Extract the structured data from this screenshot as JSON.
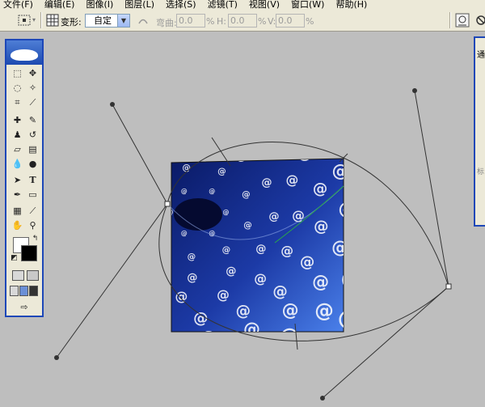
{
  "menu": [
    "文件(F)",
    "编辑(E)",
    "图像(I)",
    "图层(L)",
    "选择(S)",
    "滤镜(T)",
    "视图(V)",
    "窗口(W)",
    "帮助(H)"
  ],
  "options": {
    "warp_label": "变形:",
    "warp_value": "自定",
    "bend_label": "弯曲:",
    "bend_value": "0.0",
    "bend_unit": "%",
    "h_label": "H:",
    "h_value": "0.0",
    "h_unit": "%",
    "v_label": "V:",
    "v_value": "0.0",
    "v_unit": "%"
  },
  "toolbox": {
    "tools": [
      "rect-marquee",
      "move",
      "lasso",
      "magic-wand",
      "crop",
      "slice",
      "healing-brush",
      "brush",
      "clone-stamp",
      "history-brush",
      "eraser",
      "gradient",
      "blur",
      "dodge",
      "path-select",
      "type",
      "pen",
      "rectangle-shape",
      "notes",
      "eyedropper",
      "hand",
      "zoom"
    ],
    "type_glyph": "T"
  },
  "right_panel": {
    "tab_text": "通",
    "bottom_text": "标"
  },
  "image": {
    "glyph": "@",
    "bg_dark": "#0a1a66",
    "bg_light": "#3a6ee0",
    "text_color": "#ffffff"
  },
  "colors": {
    "accent": "#1d47b8",
    "canvas_bg": "#bebebe",
    "chrome": "#ece9d8"
  }
}
